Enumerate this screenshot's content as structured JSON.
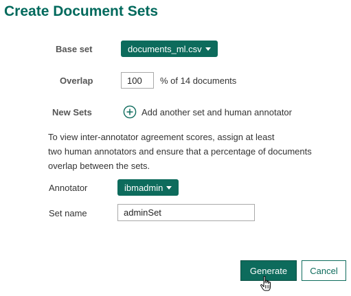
{
  "page": {
    "title": "Create Document Sets"
  },
  "form": {
    "base_set": {
      "label": "Base set",
      "value": "documents_ml.csv"
    },
    "overlap": {
      "label": "Overlap",
      "value": "100",
      "suffix": "% of 14 documents"
    },
    "new_sets": {
      "label": "New Sets",
      "add_label": "Add another set and human annotator"
    },
    "info_lines": [
      "To view inter-annotator agreement scores, assign at least",
      "two human annotators and ensure that a percentage of documents",
      "overlap between the sets."
    ],
    "annotator": {
      "label": "Annotator",
      "value": "ibmadmin"
    },
    "set_name": {
      "label": "Set name",
      "value": "adminSet"
    }
  },
  "actions": {
    "generate_label": "Generate",
    "cancel_label": "Cancel"
  },
  "colors": {
    "accent": "#0d6b5c",
    "title": "#00695c"
  },
  "icons": {
    "add": "plus-circle-icon",
    "dropdown": "caret-down-icon",
    "cursor": "hand-pointer-icon"
  }
}
